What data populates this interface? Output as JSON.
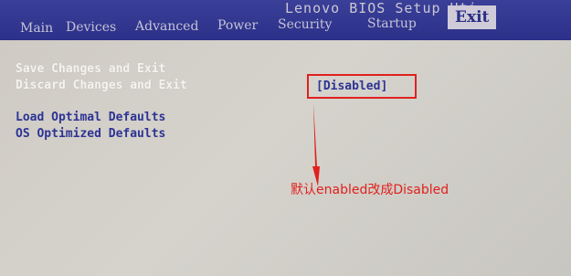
{
  "header": {
    "title": "Lenovo BIOS Setup Uti"
  },
  "tabs": [
    {
      "label": "Main",
      "active": false
    },
    {
      "label": "Devices",
      "active": false
    },
    {
      "label": "Advanced",
      "active": false
    },
    {
      "label": "Power",
      "active": false
    },
    {
      "label": "Security",
      "active": false
    },
    {
      "label": "Startup",
      "active": false
    },
    {
      "label": "Exit",
      "active": true
    }
  ],
  "menu": {
    "save_changes_exit": "Save Changes and Exit",
    "discard_changes_exit": "Discard Changes and Exit",
    "load_optimal_defaults": "Load Optimal Defaults",
    "os_optimized_defaults": "OS Optimized Defaults"
  },
  "os_optimized_value": "[Disabled]",
  "annotation": "默认enabled改成Disabled",
  "colors": {
    "bios_blue": "#2a2f86",
    "highlight_red": "#e0211d",
    "selected_text": "#f4f3ee"
  }
}
